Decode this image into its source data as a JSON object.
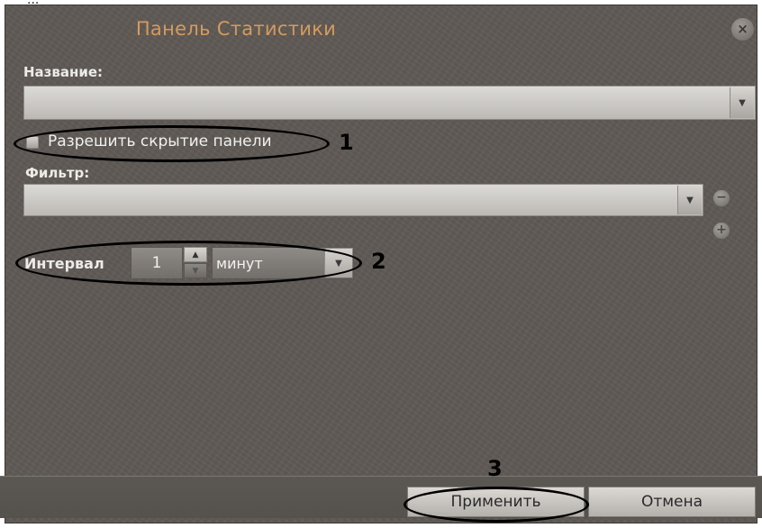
{
  "cropped_top_text": "...",
  "dialog": {
    "title": "Панель Статистики",
    "close_glyph": "×"
  },
  "fields": {
    "name_label": "Название:",
    "name_value": "",
    "allow_hide_label": "Разрешить скрытие панели",
    "allow_hide_checked": false,
    "filter_label": "Фильтр:",
    "filter_value": "",
    "filter_remove_glyph": "−",
    "filter_add_glyph": "+",
    "interval_label": "Интервал",
    "interval_value": "1",
    "interval_unit": "минут"
  },
  "buttons": {
    "apply": "Применить",
    "cancel": "Отмена"
  },
  "annotations": {
    "n1": "1",
    "n2": "2",
    "n3": "3"
  },
  "icons": {
    "dropdown_arrow": "▼",
    "spin_up": "▲",
    "spin_down": "▼"
  },
  "colors": {
    "dialog_bg": "#5f5a55",
    "title": "#d49a5f",
    "label": "#ecebe8",
    "annotation": "#000000"
  }
}
